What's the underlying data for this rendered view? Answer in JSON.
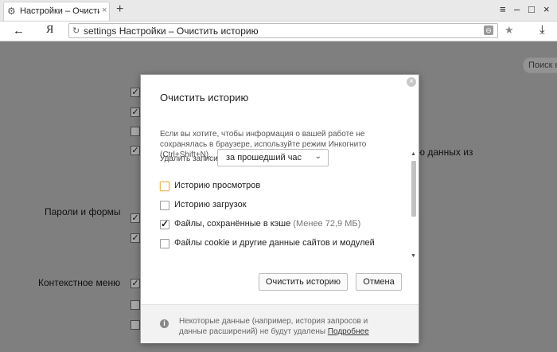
{
  "tab": {
    "title": "Настройки – Очистить и",
    "close": "×",
    "new_tab": "+"
  },
  "window_controls": {
    "menu": "≡",
    "minimize": "–",
    "maximize": "□",
    "close": "×"
  },
  "address": {
    "back": "←",
    "logo": "Я",
    "refresh": "↻",
    "url_proto": "settings",
    "url_title": "Настройки – Очистить историю",
    "bookmark": "★",
    "download": "⤓"
  },
  "background": {
    "search_placeholder": "Поиск н",
    "section_passwords": "Пароли и формы",
    "section_context": "Контекстное меню",
    "partial_text": "ю данных из"
  },
  "modal": {
    "title": "Очистить историю",
    "info": "Если вы хотите, чтобы информация о вашей работе не сохранялась в браузере, используйте режим Инкогнито (Ctrl+Shift+N).",
    "range_label": "Удалить записи:",
    "range_value": "за прошедший час",
    "options": [
      {
        "label": "Историю просмотров",
        "checked": false,
        "extra": ""
      },
      {
        "label": "Историю загрузок",
        "checked": false,
        "extra": ""
      },
      {
        "label": "Файлы, сохранённые в кэше",
        "checked": true,
        "extra": "(Менее 72,9 МБ)"
      },
      {
        "label": "Файлы cookie и другие данные сайтов и модулей",
        "checked": false,
        "extra": ""
      }
    ],
    "clear_button": "Очистить историю",
    "cancel_button": "Отмена",
    "footer_text": "Некоторые данные (например, история запросов и данные расширений) не будут удалены",
    "footer_link": "Подробнее"
  }
}
